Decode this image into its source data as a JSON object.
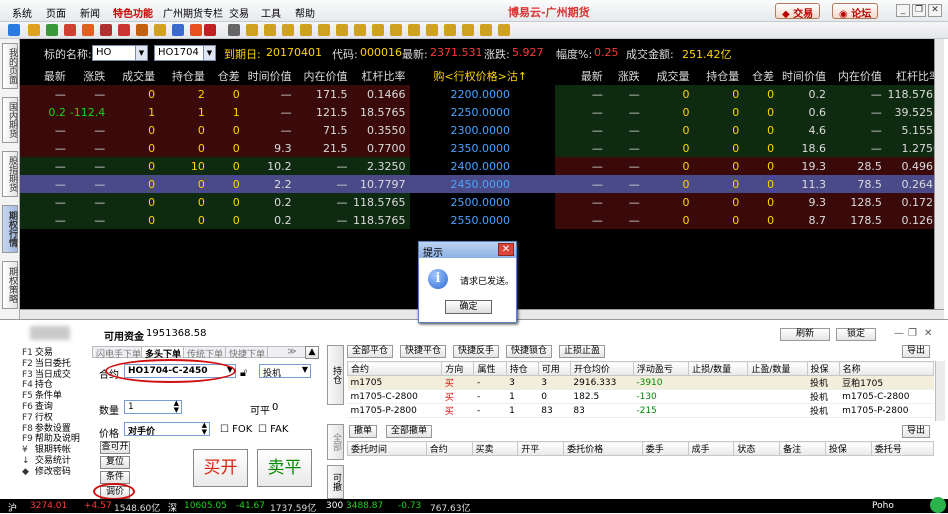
{
  "menubar": {
    "items": [
      "系统",
      "页面",
      "新闻",
      "特色功能",
      "广州期货专栏",
      "交易",
      "工具",
      "帮助"
    ],
    "app_title": "博易云-广州期货",
    "trade_button": "交易",
    "forum_button": "论坛"
  },
  "left_tabs": [
    "我的页面",
    "国内期货",
    "股指期货",
    "期权行情",
    "期权策略"
  ],
  "quote": {
    "underlying_label": "标的名称:",
    "underlying_value": "HO",
    "contract_value": "HO1704",
    "expiry_label": "到期日:",
    "expiry_value": "20170401",
    "code_label": "代码:",
    "code_value": "000016",
    "last_label": "最新:",
    "last_value": "2371.531",
    "change_label": "涨跌:",
    "change_value": "5.927",
    "pct_label": "幅度%:",
    "pct_value": "0.25",
    "turnover_label": "成交金额:",
    "turnover_value": "251.42亿",
    "headers_left": [
      "最新",
      "涨跌",
      "成交量",
      "持仓量",
      "仓差",
      "时间价值",
      "内在价值",
      "杠杆比率"
    ],
    "header_mid": "购<行权价格>沽↑",
    "headers_right": [
      "最新",
      "涨跌",
      "成交量",
      "持仓量",
      "仓差",
      "时间价值",
      "内在价值",
      "杠杆比率"
    ],
    "rows": [
      {
        "c": [
          "—",
          "—",
          "0",
          "2",
          "0",
          "—",
          "171.5",
          "0.1466"
        ],
        "strike": "2200.0000",
        "p": [
          "—",
          "—",
          "0",
          "0",
          "0",
          "0.2",
          "—",
          "118.5765"
        ]
      },
      {
        "c": [
          "0.2",
          "-112.4",
          "1",
          "1",
          "1",
          "—",
          "121.5",
          "18.5765"
        ],
        "strike": "2250.0000",
        "p": [
          "—",
          "—",
          "0",
          "0",
          "0",
          "0.6",
          "—",
          "39.5255"
        ]
      },
      {
        "c": [
          "—",
          "—",
          "0",
          "0",
          "0",
          "—",
          "71.5",
          "0.3550"
        ],
        "strike": "2300.0000",
        "p": [
          "—",
          "—",
          "0",
          "0",
          "0",
          "4.6",
          "—",
          "5.1555"
        ]
      },
      {
        "c": [
          "—",
          "—",
          "0",
          "0",
          "0",
          "9.3",
          "21.5",
          "0.7700"
        ],
        "strike": "2350.0000",
        "p": [
          "—",
          "—",
          "0",
          "0",
          "0",
          "18.6",
          "—",
          "1.2750"
        ]
      },
      {
        "c": [
          "—",
          "—",
          "0",
          "10",
          "0",
          "10.2",
          "—",
          "2.3250"
        ],
        "strike": "2400.0000",
        "p": [
          "—",
          "—",
          "0",
          "0",
          "0",
          "19.3",
          "28.5",
          "0.4961"
        ]
      },
      {
        "c": [
          "—",
          "—",
          "0",
          "0",
          "0",
          "2.2",
          "—",
          "10.7797"
        ],
        "strike": "2450.0000",
        "p": [
          "—",
          "—",
          "0",
          "0",
          "0",
          "11.3",
          "78.5",
          "0.2641"
        ]
      },
      {
        "c": [
          "—",
          "—",
          "0",
          "0",
          "0",
          "0.2",
          "—",
          "118.5765"
        ],
        "strike": "2500.0000",
        "p": [
          "—",
          "—",
          "0",
          "0",
          "0",
          "9.3",
          "128.5",
          "0.1721"
        ]
      },
      {
        "c": [
          "—",
          "—",
          "0",
          "0",
          "0",
          "0.2",
          "—",
          "118.5765"
        ],
        "strike": "2550.0000",
        "p": [
          "—",
          "—",
          "0",
          "0",
          "0",
          "8.7",
          "178.5",
          "0.1267"
        ]
      }
    ]
  },
  "dialog": {
    "title": "提示",
    "message": "请求已发送。",
    "ok": "确定"
  },
  "order": {
    "funds_label": "可用资金",
    "funds_value": "1951368.58",
    "function_keys": [
      {
        "key": "F1",
        "label": "交易"
      },
      {
        "key": "F2",
        "label": "当日委托"
      },
      {
        "key": "F3",
        "label": "当日成交"
      },
      {
        "key": "F4",
        "label": "持仓"
      },
      {
        "key": "F5",
        "label": "条件单"
      },
      {
        "key": "F6",
        "label": "查询"
      },
      {
        "key": "F7",
        "label": "行权"
      },
      {
        "key": "F8",
        "label": "参数设置"
      },
      {
        "key": "F9",
        "label": "帮助及说明"
      },
      {
        "key": "¥",
        "label": "银期转帐"
      },
      {
        "key": "↓",
        "label": "交易统计"
      },
      {
        "key": "◆",
        "label": "修改密码"
      }
    ],
    "subtabs": [
      "闪电手下单",
      "多头下单",
      "传统下单",
      "快捷下单"
    ],
    "contract_label": "合约",
    "contract_value": "HO1704-C-2450",
    "hedge_value": "投机",
    "qty_label": "数量",
    "qty_value": "1",
    "avail_label": "可平",
    "avail_value": "0",
    "price_label": "价格",
    "price_value": "对手价",
    "fok": "FOK",
    "fak": "FAK",
    "btn_check_open": "查可开",
    "btn_reset": "复位",
    "btn_condition": "条件",
    "btn_adjust": "调价",
    "buy_open": "买开",
    "sell_close": "卖平",
    "side_tabs": [
      "持仓",
      "全部",
      "可撤"
    ]
  },
  "positions": {
    "refresh": "刷新",
    "lock": "锁定",
    "export": "导出",
    "buttons": [
      "全部平仓",
      "快捷平仓",
      "快捷反手",
      "快捷锁仓",
      "止损止盈"
    ],
    "headers": [
      "合约",
      "方向",
      "属性",
      "持仓",
      "可用",
      "开仓均价",
      "浮动盈亏",
      "止损/数量",
      "止盈/数量",
      "投保",
      "名称"
    ],
    "rows": [
      {
        "contract": "m1705",
        "dir": "买",
        "attr": "-",
        "hold": "3",
        "avail": "3",
        "avg": "2916.333",
        "pnl": "-3910",
        "sl": "",
        "tp": "",
        "hedge": "投机",
        "name": "豆粕1705"
      },
      {
        "contract": "m1705-C-2800",
        "dir": "买",
        "attr": "-",
        "hold": "1",
        "avail": "0",
        "avg": "182.5",
        "pnl": "-130",
        "sl": "",
        "tp": "",
        "hedge": "投机",
        "name": "m1705-C-2800"
      },
      {
        "contract": "m1705-P-2800",
        "dir": "买",
        "attr": "-",
        "hold": "1",
        "avail": "83",
        "avg": "83",
        "pnl": "-215",
        "sl": "",
        "tp": "",
        "hedge": "投机",
        "name": "m1705-P-2800"
      }
    ]
  },
  "orders": {
    "cancel": "撤单",
    "cancel_all": "全部撤单",
    "export": "导出",
    "headers": [
      "委托时间",
      "合约",
      "买卖",
      "开平",
      "委托价格",
      "委手",
      "成手",
      "状态",
      "备注",
      "投保",
      "委托号"
    ]
  },
  "statusbar": {
    "items": [
      "沪",
      "3274.01",
      "+4.57",
      "1548.60亿",
      "深",
      "10605.05",
      "-41.67",
      "1737.59亿",
      "300",
      "3488.87",
      "-0.73",
      "767.63亿",
      "Poho"
    ]
  }
}
